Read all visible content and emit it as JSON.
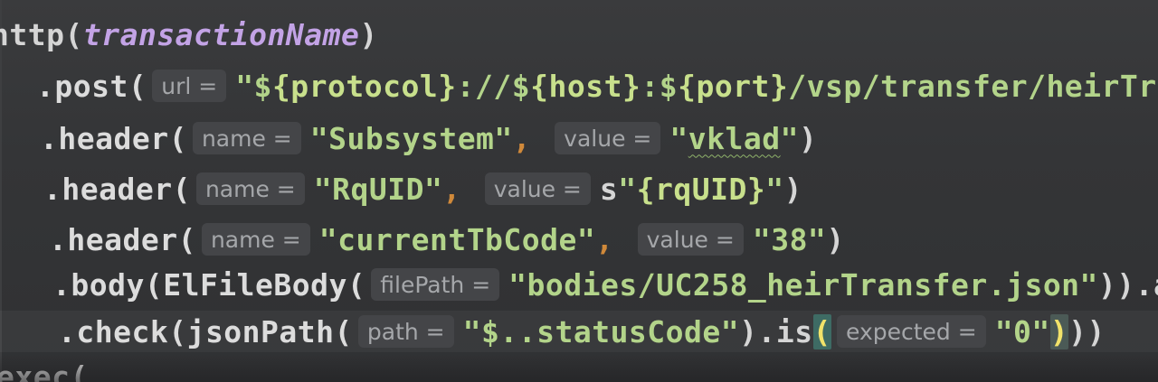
{
  "editor": {
    "line1": {
      "fn": "http(",
      "param": "transactionName",
      "close": ")"
    },
    "line2": {
      "method": ".post(",
      "hint": "url =",
      "str_a": "\"$",
      "interp_a": "{protocol}",
      "str_b": "://$",
      "interp_b": "{host}",
      "str_c": ":$",
      "interp_c": "{port}",
      "str_d": "/vsp/transfer/heirTransfer"
    },
    "line3": {
      "method": ".header(",
      "hint_name": "name =",
      "name_val": "\"Subsystem\"",
      "comma": ",",
      "hint_value": "value =",
      "value_q1": "\"",
      "value_word": "vklad",
      "value_q2": "\"",
      "close": ")"
    },
    "line4": {
      "method": ".header(",
      "hint_name": "name =",
      "name_val": "\"RqUID\"",
      "comma": ",",
      "hint_value": "value =",
      "value_prefix": "s",
      "value_q1": "\"",
      "value_interp": "{rqUID}",
      "value_q2": "\"",
      "close": ")"
    },
    "line5": {
      "method": ".header(",
      "hint_name": "name =",
      "name_val": "\"currentTbCode\"",
      "comma": ",",
      "hint_value": "value =",
      "value_val": "\"38\"",
      "close": ")"
    },
    "line6": {
      "method": ".body(ElFileBody(",
      "hint": "filePath =",
      "path_val": "\"bodies/UC258_heirTransfer.json\"",
      "close": ")).asJson"
    },
    "line7": {
      "method": ".check(jsonPath(",
      "hint_path": "path =",
      "path_val": "\"$..statusCode\"",
      "mid": ").is",
      "open_bracket": "(",
      "hint_expected": "expected =",
      "expected_val": "\"0\"",
      "close_bracket": ")",
      "close_rest": "))"
    },
    "line8": {
      "text": "exec("
    }
  }
}
